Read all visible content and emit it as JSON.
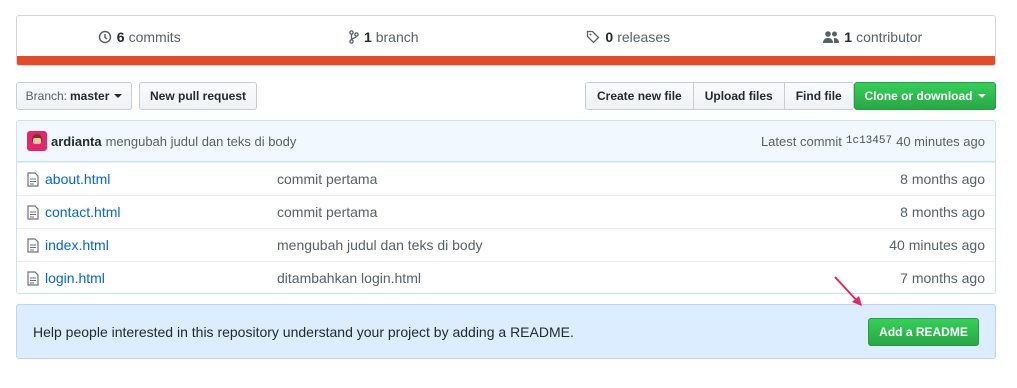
{
  "summary": {
    "commits_count": "6",
    "commits_label": "commits",
    "branches_count": "1",
    "branches_label": "branch",
    "releases_count": "0",
    "releases_label": "releases",
    "contributors_count": "1",
    "contributors_label": "contributor",
    "language_color": "#e34c26"
  },
  "toolbar": {
    "branch_prefix": "Branch:",
    "branch_name": "master",
    "new_pr": "New pull request",
    "create_file": "Create new file",
    "upload_files": "Upload files",
    "find_file": "Find file",
    "clone": "Clone or download"
  },
  "commit": {
    "author": "ardianta",
    "message": "mengubah judul dan teks di body",
    "latest_label": "Latest commit",
    "sha": "1c13457",
    "age": "40 minutes ago"
  },
  "files": [
    {
      "name": "about.html",
      "message": "commit pertama",
      "age": "8 months ago"
    },
    {
      "name": "contact.html",
      "message": "commit pertama",
      "age": "8 months ago"
    },
    {
      "name": "index.html",
      "message": "mengubah judul dan teks di body",
      "age": "40 minutes ago"
    },
    {
      "name": "login.html",
      "message": "ditambahkan login.html",
      "age": "7 months ago"
    }
  ],
  "readme": {
    "text": "Help people interested in this repository understand your project by adding a README.",
    "button": "Add a README"
  },
  "colors": {
    "accent_green": "#28a745",
    "link_blue": "#0366d6",
    "arrow": "#e3256b"
  }
}
